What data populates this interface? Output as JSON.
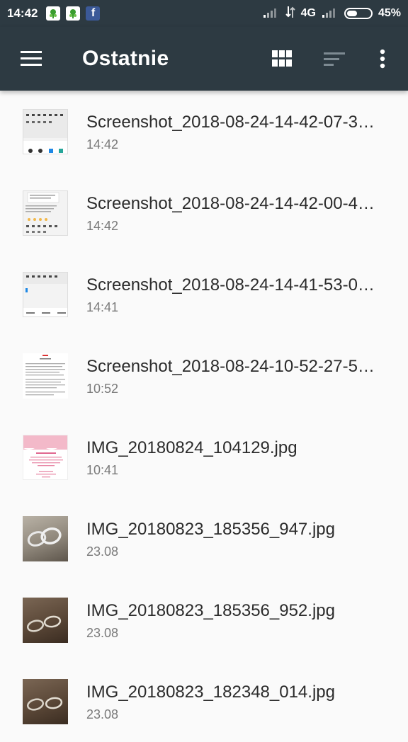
{
  "status_bar": {
    "time": "14:42",
    "network": "4G",
    "battery_percent": "45%",
    "battery_level": 0.45,
    "notification_icons": [
      "leaf-app-icon",
      "leaf-app-icon",
      "facebook-icon"
    ],
    "facebook_letter": "f"
  },
  "app_bar": {
    "title": "Ostatnie",
    "actions": [
      "menu-icon",
      "grid-view-icon",
      "sort-icon",
      "more-vert-icon"
    ]
  },
  "files": [
    {
      "name": "Screenshot_2018-08-24-14-42-07-3…",
      "time": "14:42",
      "thumb": "screenshot"
    },
    {
      "name": "Screenshot_2018-08-24-14-42-00-4…",
      "time": "14:42",
      "thumb": "screenshot"
    },
    {
      "name": "Screenshot_2018-08-24-14-41-53-0…",
      "time": "14:41",
      "thumb": "screenshot"
    },
    {
      "name": "Screenshot_2018-08-24-10-52-27-5…",
      "time": "10:52",
      "thumb": "screenshot"
    },
    {
      "name": "IMG_20180824_104129.jpg",
      "time": "10:41",
      "thumb": "pink-card"
    },
    {
      "name": "IMG_20180823_185356_947.jpg",
      "time": "23.08",
      "thumb": "photo-rings"
    },
    {
      "name": "IMG_20180823_185356_952.jpg",
      "time": "23.08",
      "thumb": "photo-rings"
    },
    {
      "name": "IMG_20180823_182348_014.jpg",
      "time": "23.08",
      "thumb": "photo-rings"
    }
  ],
  "colors": {
    "app_bar": "#2d3a42",
    "background": "#fafafa",
    "primary_text": "#2b2b2b",
    "secondary_text": "#7a7a7a"
  }
}
